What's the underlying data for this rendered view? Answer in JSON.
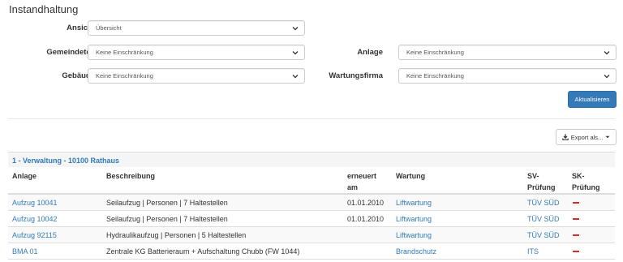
{
  "page": {
    "title": "Instandhaltung"
  },
  "filters": {
    "ansicht": {
      "label": "Ansicht",
      "value": "Übersicht"
    },
    "gemeindeteil": {
      "label": "Gemeindeteil",
      "value": "Keine Einschränkung"
    },
    "gebaeude": {
      "label": "Gebäude",
      "value": "Keine Einschränkung"
    },
    "anlage": {
      "label": "Anlage",
      "value": "Keine Einschränkung"
    },
    "wartungsfirma": {
      "label": "Wartungsfirma",
      "value": "Keine Einschränkung"
    }
  },
  "buttons": {
    "refresh": "Aktualisieren",
    "export": "Export als..."
  },
  "section": {
    "title": "1 - Verwaltung - 10100 Rathaus"
  },
  "table": {
    "headers": {
      "anlage": "Anlage",
      "beschreibung": "Beschreibung",
      "erneuert_line1": "erneuert",
      "erneuert_line2": "am",
      "wartung": "Wartung",
      "sv_line1": "SV-",
      "sv_line2": "Prüfung",
      "sk_line1": "SK-",
      "sk_line2": "Prüfung"
    },
    "rows": [
      {
        "anlage": "Aufzug 10041",
        "beschreibung": "Seilaufzug | Personen | 7 Haltestellen",
        "erneuert": "01.01.2010",
        "wartung": "Liftwartung",
        "sv": "TÜV SÜD",
        "sk": "-"
      },
      {
        "anlage": "Aufzug 10042",
        "beschreibung": "Seilaufzug | Personen | 7 Haltestellen",
        "erneuert": "01.01.2010",
        "wartung": "Liftwartung",
        "sv": "TÜV SÜD",
        "sk": "-"
      },
      {
        "anlage": "Aufzug 92115",
        "beschreibung": "Hydraulikaufzug | Personen | 5 Haltestellen",
        "erneuert": "",
        "wartung": "Liftwartung",
        "sv": "TÜV SÜD",
        "sk": "-"
      },
      {
        "anlage": "BMA 01",
        "beschreibung": "Zentrale KG Batterieraum + Aufschaltung Chubb (FW 1044)",
        "erneuert": "",
        "wartung": "Brandschutz",
        "sv": "ITS",
        "sk": "-"
      }
    ]
  },
  "colors": {
    "link": "#337ab7",
    "primary": "#337ab7",
    "danger": "#c9302c",
    "stripe": "#f9f9f9"
  }
}
